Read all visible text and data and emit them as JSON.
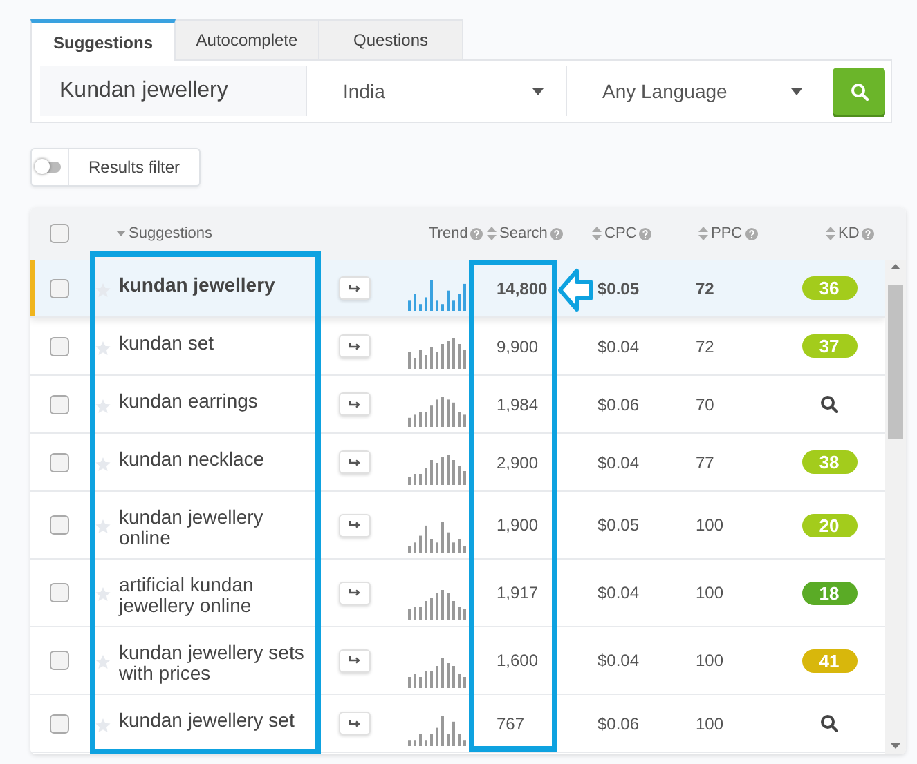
{
  "tabs": [
    {
      "label": "Suggestions",
      "selected": true
    },
    {
      "label": "Autocomplete",
      "selected": false
    },
    {
      "label": "Questions",
      "selected": false
    }
  ],
  "search": {
    "keyword": "Kundan jewellery",
    "country": "India",
    "language": "Any Language"
  },
  "filter": {
    "label": "Results filter",
    "on": false
  },
  "table": {
    "select_all": {
      "checked": false
    },
    "columns": [
      "Suggestions",
      "Trend",
      "Search",
      "CPC",
      "PPC",
      "KD"
    ],
    "rows": [
      {
        "keyword": "kundan jewellery",
        "checked": false,
        "selected": true,
        "search": "14,800",
        "cpc": "$0.05",
        "ppc": "72",
        "kd": {
          "kind": "badge",
          "value": "36",
          "color": "#a3cc1c"
        }
      },
      {
        "keyword": "kundan set",
        "checked": false,
        "selected": false,
        "search": "9,900",
        "cpc": "$0.04",
        "ppc": "72",
        "kd": {
          "kind": "badge",
          "value": "37",
          "color": "#a3cc1c"
        }
      },
      {
        "keyword": "kundan earrings",
        "checked": false,
        "selected": false,
        "search": "1,984",
        "cpc": "$0.06",
        "ppc": "70",
        "kd": {
          "kind": "lookup"
        }
      },
      {
        "keyword": "kundan necklace",
        "checked": false,
        "selected": false,
        "search": "2,900",
        "cpc": "$0.04",
        "ppc": "77",
        "kd": {
          "kind": "badge",
          "value": "38",
          "color": "#a3cc1c"
        }
      },
      {
        "keyword": "kundan jewellery online",
        "checked": false,
        "selected": false,
        "search": "1,900",
        "cpc": "$0.05",
        "ppc": "100",
        "kd": {
          "kind": "badge",
          "value": "20",
          "color": "#a3cc1c"
        }
      },
      {
        "keyword": "artificial kundan jewellery online",
        "checked": false,
        "selected": false,
        "search": "1,917",
        "cpc": "$0.04",
        "ppc": "100",
        "kd": {
          "kind": "badge",
          "value": "18",
          "color": "#5aab26"
        }
      },
      {
        "keyword": "kundan jewellery sets with prices",
        "checked": false,
        "selected": false,
        "search": "1,600",
        "cpc": "$0.04",
        "ppc": "100",
        "kd": {
          "kind": "badge",
          "value": "41",
          "color": "#d8b70c"
        }
      },
      {
        "keyword": "kundan jewellery set",
        "checked": false,
        "selected": false,
        "search": "767",
        "cpc": "$0.06",
        "ppc": "100",
        "kd": {
          "kind": "lookup"
        }
      }
    ]
  }
}
